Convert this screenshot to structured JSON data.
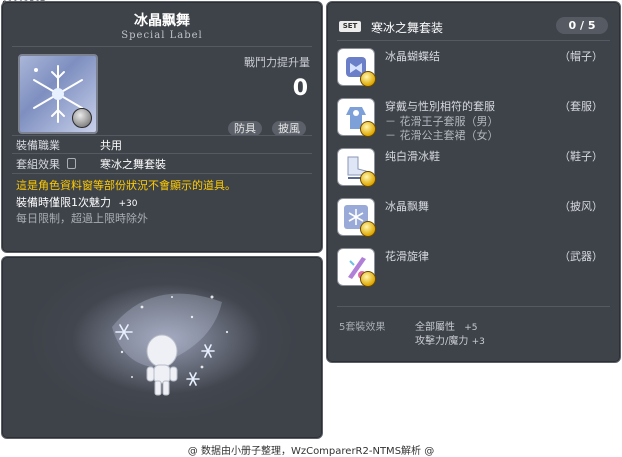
{
  "item_id": "01103567",
  "item": {
    "name": "冰晶飘舞",
    "label": "Special Label",
    "power_label": "戰鬥力提升量",
    "power_value": "0",
    "tags": [
      "防具",
      "披風"
    ],
    "job_label": "裝備職業",
    "job_value": "共用",
    "set_label": "套組效果",
    "set_value": "寒冰之舞套裝",
    "desc_highlight": "這是角色資料窗等部份狀況不會顯示的道具。",
    "limit_label": "裝備時僅限1次魅力",
    "limit_value": "+30",
    "limit_note": "每日限制，超過上限時除外"
  },
  "set_panel": {
    "badge": "SET",
    "name": "寒冰之舞套装",
    "count": "0 / 5",
    "items": [
      {
        "name": "冰晶蝴蝶结",
        "category": "（帽子）",
        "sub": []
      },
      {
        "name": "穿戴与性別相符的套服",
        "category": "（套服）",
        "sub": [
          "－ 花滑王子套服（男）",
          "－ 花滑公主套裙（女）"
        ]
      },
      {
        "name": "纯白滑冰鞋",
        "category": "（鞋子）",
        "sub": []
      },
      {
        "name": "冰晶飘舞",
        "category": "（披风）",
        "sub": []
      },
      {
        "name": "花滑旋律",
        "category": "（武器）",
        "sub": []
      }
    ],
    "effect_label": "5套裝效果",
    "effect_line1": "全部屬性",
    "effect_value1": "+5",
    "effect_line2": "攻擊力/魔力",
    "effect_value2": "+3"
  },
  "footer": "@ 数据由小册子整理，WzComparerR2-NTMS解析 @",
  "icons": [
    "snowflake-icon",
    "cash-coin-icon",
    "ribbon-icon",
    "suit-icon",
    "skate-icon",
    "cape-icon",
    "weapon-icon"
  ]
}
